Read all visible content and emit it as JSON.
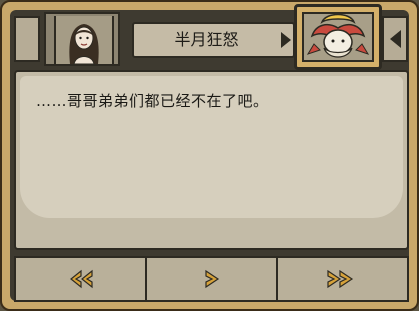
{
  "header": {
    "portrait_icon": "female-portrait-icon",
    "speaker_name": "半月狂怒",
    "speaker_icon": "moon-goddess-portrait-icon"
  },
  "dialogue": {
    "text": "……哥哥弟弟们都已经不在了吧。"
  },
  "controls": {
    "prev_icon": "double-arrow-left-icon",
    "next_icon": "arrow-right-icon",
    "fast_forward_icon": "double-arrow-right-icon"
  },
  "colors": {
    "frame_gold": "#c9a86a",
    "panel_gray": "#c3bba7",
    "icon_gold": "#d6a23a",
    "outline": "#2d2a22"
  }
}
